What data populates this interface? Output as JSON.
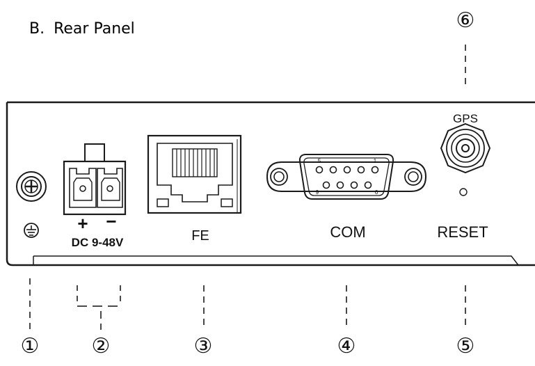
{
  "heading": {
    "letter": "B.",
    "title": "Rear Panel"
  },
  "labels": {
    "gps": "GPS",
    "fe": "FE",
    "com": "COM",
    "reset": "RESET",
    "power_plus": "+",
    "power_minus": "−",
    "power_rating": "DC 9-48V",
    "pin_1": "1",
    "pin_5": "5",
    "pin_6": "6",
    "pin_9": "9"
  },
  "callouts": {
    "c1": "①",
    "c2": "②",
    "c3": "③",
    "c4": "④",
    "c5": "⑤",
    "c6": "⑥"
  },
  "icons": {
    "ground": "ground-symbol-icon",
    "screw": "ground-screw-icon",
    "terminal": "terminal-block-icon",
    "ethernet": "rj45-port-icon",
    "db9": "db9-connector-icon",
    "antenna": "sma-connector-icon"
  },
  "colors": {
    "line": "#1a1a1a",
    "background": "#ffffff"
  }
}
